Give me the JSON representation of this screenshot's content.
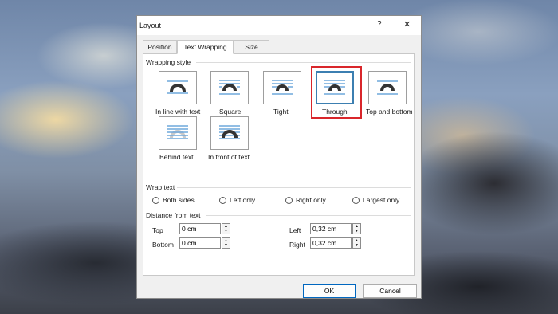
{
  "dialog": {
    "title": "Layout",
    "help": "?",
    "close": "✕"
  },
  "tabs": [
    {
      "label": "Position"
    },
    {
      "label": "Text Wrapping"
    },
    {
      "label": "Size"
    }
  ],
  "active_tab": "Text Wrapping",
  "wrapping_style": {
    "label": "Wrapping style",
    "options": [
      {
        "label": "In line with text"
      },
      {
        "label": "Square"
      },
      {
        "label": "Tight"
      },
      {
        "label": "Through"
      },
      {
        "label": "Top and bottom"
      },
      {
        "label": "Behind text"
      },
      {
        "label": "In front of text"
      }
    ],
    "selected": "Through"
  },
  "wrap_text": {
    "label": "Wrap text",
    "options": [
      {
        "label": "Both sides"
      },
      {
        "label": "Left only"
      },
      {
        "label": "Right only"
      },
      {
        "label": "Largest only"
      }
    ]
  },
  "distance": {
    "label": "Distance from text",
    "top": {
      "label": "Top",
      "value": "0 cm"
    },
    "bottom": {
      "label": "Bottom",
      "value": "0 cm"
    },
    "left": {
      "label": "Left",
      "value": "0,32 cm"
    },
    "right": {
      "label": "Right",
      "value": "0,32 cm"
    }
  },
  "buttons": {
    "ok": "OK",
    "cancel": "Cancel"
  },
  "colors": {
    "highlight": "#d9262b",
    "accent": "#3c7fb1",
    "line_blue": "#6fa8dc"
  }
}
